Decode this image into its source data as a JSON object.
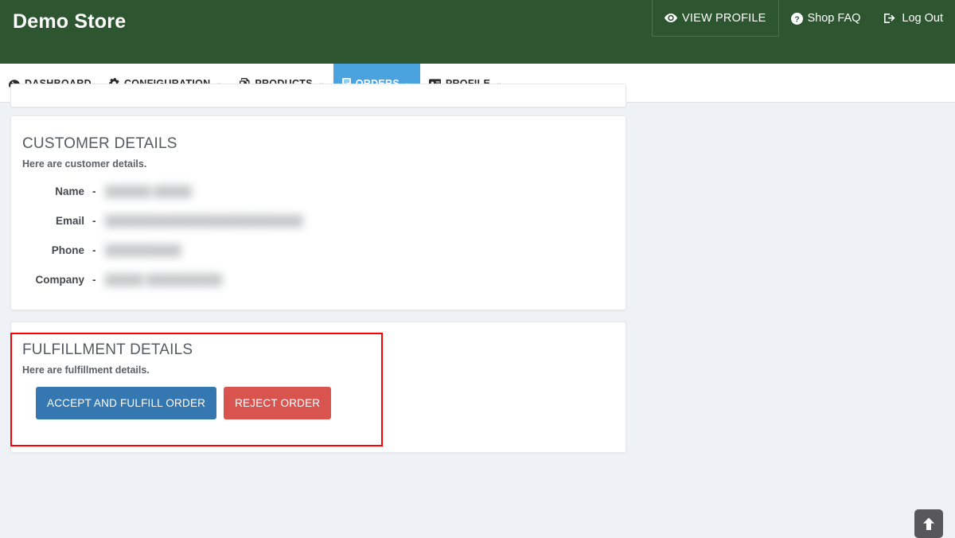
{
  "header": {
    "brand": "Demo Store",
    "nav": [
      {
        "label": "VIEW PROFILE",
        "icon": "eye-icon",
        "boxed": true
      },
      {
        "label": "Shop FAQ",
        "icon": "question-circle-icon",
        "boxed": false
      },
      {
        "label": "Log Out",
        "icon": "sign-out-icon",
        "boxed": false
      }
    ]
  },
  "mainnav": {
    "items": [
      {
        "label": "DASHBOARD",
        "icon": "tachometer-icon",
        "caret": false,
        "active": false
      },
      {
        "label": "CONFIGURATION",
        "icon": "gear-icon",
        "caret": true,
        "active": false
      },
      {
        "label": "PRODUCTS",
        "icon": "copy-icon",
        "caret": true,
        "active": false
      },
      {
        "label": "ORDERS",
        "icon": "book-icon",
        "caret": true,
        "active": true
      },
      {
        "label": "PROFILE",
        "icon": "id-card-icon",
        "caret": true,
        "active": false
      }
    ],
    "caret_glyph": "⌄",
    "active_color": "#4aa3df"
  },
  "customer_card": {
    "title": "CUSTOMER DETAILS",
    "subtitle": "Here are customer details.",
    "dash": "-",
    "rows": [
      {
        "label": "Name",
        "value": "██████ █████"
      },
      {
        "label": "Email",
        "value": "██████████████████████████"
      },
      {
        "label": "Phone",
        "value": "██████████"
      },
      {
        "label": "Company",
        "value": "█████ ██████████"
      }
    ]
  },
  "fulfillment_card": {
    "title": "FULFILLMENT DETAILS",
    "subtitle": "Here are fulfillment details.",
    "accept_label": "ACCEPT AND FULFILL ORDER",
    "reject_label": "REJECT ORDER",
    "accept_color": "#3577b0",
    "reject_color": "#d9534f"
  },
  "annotation": {
    "color": "#ff0000"
  },
  "scroll_top": {
    "icon": "arrow-up-icon"
  },
  "colors": {
    "header_green": "#2c5530",
    "page_background": "#eef1f5",
    "card_background": "#ffffff"
  }
}
